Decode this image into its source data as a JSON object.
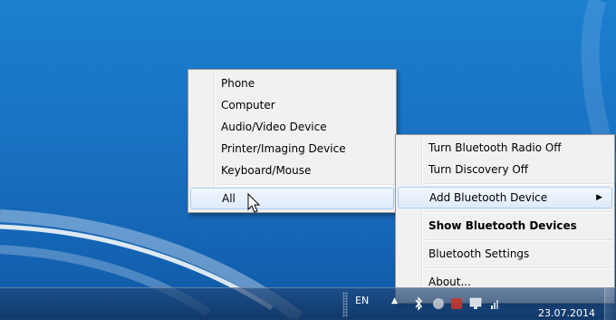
{
  "submenu": {
    "items": [
      "Phone",
      "Computer",
      "Audio/Video Device",
      "Printer/Imaging Device",
      "Keyboard/Mouse"
    ],
    "all": "All"
  },
  "tray_menu": {
    "radio_off": "Turn Bluetooth Radio Off",
    "discovery_off": "Turn Discovery Off",
    "add_device": "Add Bluetooth Device",
    "show_devices": "Show Bluetooth Devices",
    "settings": "Bluetooth Settings",
    "about": "About..."
  },
  "taskbar": {
    "language": "EN",
    "clock_time": "",
    "clock_date": "23.07.2014",
    "icons": [
      "show-hidden-icons",
      "bluetooth-icon",
      "action-center-icon",
      "network-icon",
      "volume-icon"
    ]
  },
  "colors": {
    "desktop": "#1a73c4",
    "menu_bg": "#f1f1f1",
    "highlight_border": "#a8cdf5"
  }
}
